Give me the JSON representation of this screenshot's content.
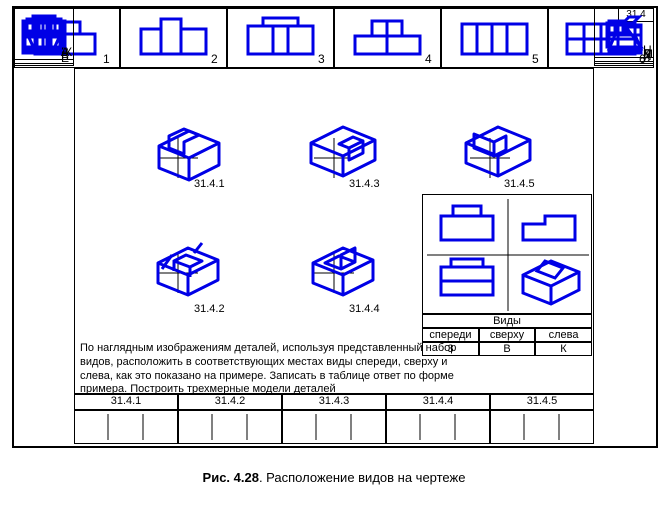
{
  "corner_label": "31.4",
  "top_row": [
    "1",
    "2",
    "3",
    "4",
    "5",
    "6"
  ],
  "left_col": [
    "Ж",
    "Е",
    "Г",
    "В",
    "Б",
    "А"
  ],
  "right_col": [
    "З",
    "И",
    "К",
    "Л",
    "М",
    "Н"
  ],
  "iso_labels": [
    "31.4.1",
    "31.4.3",
    "31.4.5",
    "31.4.2",
    "31.4.4"
  ],
  "views_header": "Виды",
  "views_cols": [
    "спереди",
    "сверху",
    "слева"
  ],
  "example_row": [
    "3",
    "В",
    "К"
  ],
  "answer_cols": [
    "31.4.1",
    "31.4.2",
    "31.4.3",
    "31.4.4",
    "31.4.5"
  ],
  "instruction": "По наглядным изображениям деталей, используя представленный набор видов, расположить в соответствующих местах виды спереди, сверху и слева, как это показано на примере. Записать в таблице ответ по форме примера. Построить трехмерные модели деталей",
  "caption_bold": "Рис. 4.28",
  "caption_rest": ". Расположение видов на чертеже"
}
